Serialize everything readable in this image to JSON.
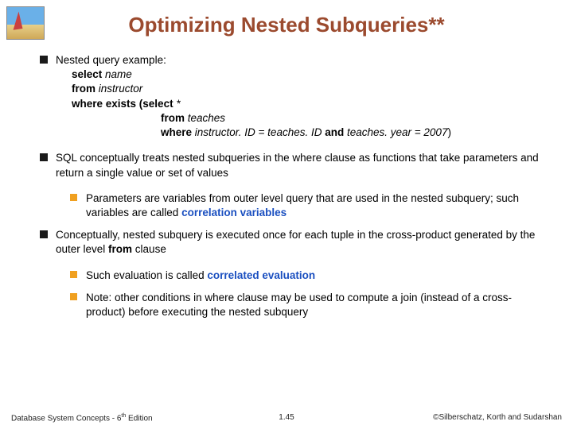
{
  "title": "Optimizing Nested Subqueries**",
  "bullets": {
    "b1_1_intro": "Nested query example:",
    "q_select": "select ",
    "q_name": "name",
    "q_from": "from ",
    "q_instructor": "instructor",
    "q_where_exists": "where exists (select ",
    "q_star": "*",
    "q_from2": "from ",
    "q_teaches": "teaches",
    "q_where2a": "where ",
    "q_cond1": "instructor. ID = teaches. ID ",
    "q_and": "and ",
    "q_cond2": "teaches. year = 2007",
    "q_close": ")",
    "b1_2": "SQL conceptually treats nested subqueries in the where clause as functions that take parameters and return a single value or set of values",
    "b2_1a": "Parameters are variables from outer level query that are used in the nested subquery; such variables are called ",
    "b2_1hl": "correlation variables",
    "b1_3a": "Conceptually, nested subquery is executed once for each tuple in the cross-product generated by the outer level ",
    "b1_3bold": "from",
    "b1_3b": " clause",
    "b2_2a": "Such evaluation is called ",
    "b2_2hl": "correlated evaluation",
    "b2_3": "Note: other conditions in where clause may be used to compute a join (instead of a cross-product) before executing the nested subquery"
  },
  "footer": {
    "left_a": "Database System Concepts - 6",
    "left_sup": "th",
    "left_b": " Edition",
    "mid": "1.45",
    "right": "©Silberschatz, Korth and Sudarshan"
  }
}
